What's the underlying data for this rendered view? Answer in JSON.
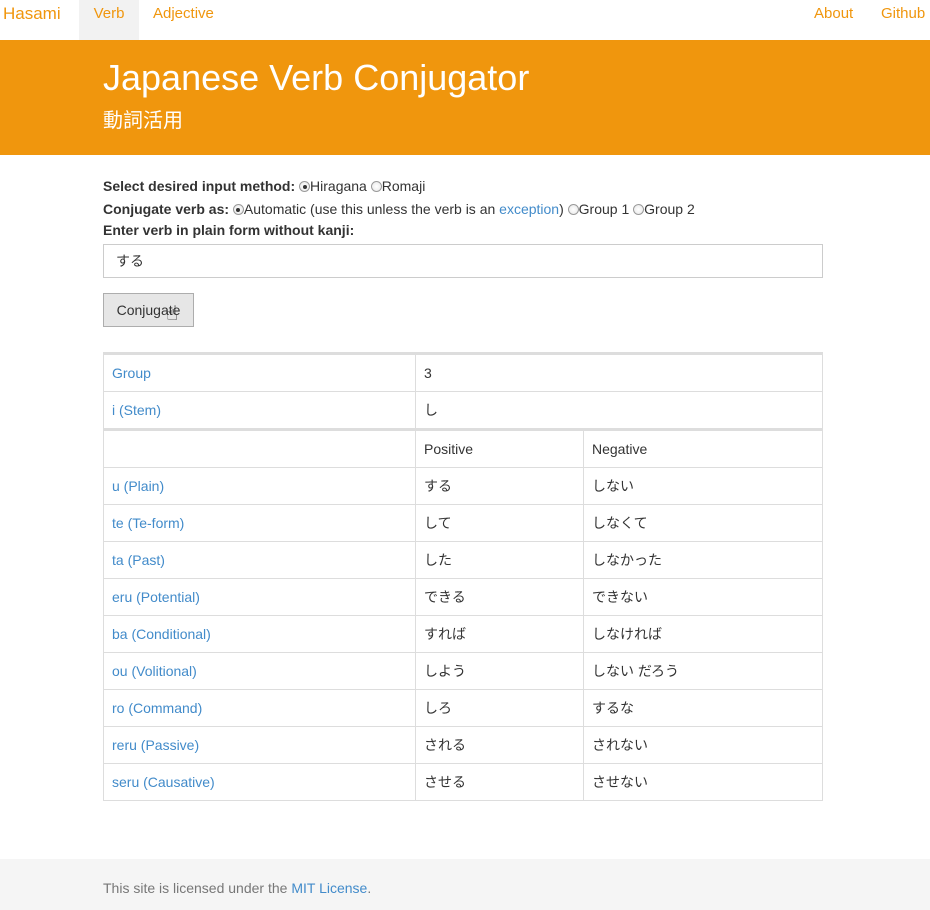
{
  "nav": {
    "brand": "Hasami",
    "verb": "Verb",
    "adjective": "Adjective",
    "about": "About",
    "github": "Github"
  },
  "header": {
    "title": "Japanese Verb Conjugator",
    "subtitle": "動詞活用"
  },
  "form": {
    "input_method_label": "Select desired input method:",
    "input_methods": [
      "Hiragana",
      "Romaji"
    ],
    "selected_input_method": "Hiragana",
    "conjugate_as_label": "Conjugate verb as:",
    "conjugate_auto_pre": "Automatic (use this unless the verb is an ",
    "conjugate_auto_link": "exception",
    "conjugate_auto_post": ")",
    "conjugate_group1": "Group 1",
    "conjugate_group2": "Group 2",
    "selected_conjugate": "Automatic",
    "verb_label": "Enter verb in plain form without kanji:",
    "verb_value": "する",
    "submit_label": "Conjugate"
  },
  "info_table": [
    {
      "label": "Group",
      "value": "3"
    },
    {
      "label": "i (Stem)",
      "value": "し"
    }
  ],
  "conj_table": {
    "headers": [
      "",
      "Positive",
      "Negative"
    ],
    "rows": [
      {
        "label": "u (Plain)",
        "positive": "する",
        "negative": "しない"
      },
      {
        "label": "te (Te-form)",
        "positive": "して",
        "negative": "しなくて"
      },
      {
        "label": "ta (Past)",
        "positive": "した",
        "negative": "しなかった"
      },
      {
        "label": "eru (Potential)",
        "positive": "できる",
        "negative": "できない"
      },
      {
        "label": "ba (Conditional)",
        "positive": "すれば",
        "negative": "しなければ"
      },
      {
        "label": "ou (Volitional)",
        "positive": "しよう",
        "negative": "しない だろう"
      },
      {
        "label": "ro (Command)",
        "positive": "しろ",
        "negative": "するな"
      },
      {
        "label": "reru (Passive)",
        "positive": "される",
        "negative": "されない"
      },
      {
        "label": "seru (Causative)",
        "positive": "させる",
        "negative": "させない"
      }
    ]
  },
  "footer": {
    "pre": "This site is licensed under the ",
    "link": "MIT License",
    "post": "."
  },
  "colors": {
    "brand": "#f0960d",
    "link": "#428bca"
  }
}
